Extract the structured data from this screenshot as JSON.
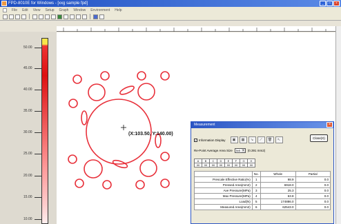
{
  "window": {
    "title": "FPD-8010E for Windows - [xxg sample fpd]"
  },
  "menu": [
    "File",
    "Edit",
    "View",
    "Setup",
    "Graph",
    "Window",
    "Environment",
    "Help"
  ],
  "scale": {
    "labels": [
      "50.00",
      "45.00",
      "40.00",
      "35.00",
      "30.00",
      "25.00",
      "20.00",
      "15.00",
      "10.00"
    ]
  },
  "canvas": {
    "coordinate": "(X:103.50, Y:140.00)"
  },
  "dialog": {
    "title": "Measurement",
    "info_display_label": "Information Display",
    "close_label": "Close(X)",
    "rp_area_label": "Re-Point Average Area Size",
    "rp_area_value": "5x5",
    "rp_area_unit": "(0.391 mm2)",
    "letters": [
      "A",
      "B",
      "C",
      "D",
      "E",
      "F",
      "G",
      "H"
    ],
    "letter_values": [
      "00",
      "00",
      "00",
      "00",
      "00",
      "00",
      "00",
      "00"
    ],
    "columns": [
      "No.",
      "Whole",
      "Partial"
    ],
    "rows": [
      {
        "label": "Prescale Effective Ratio(%)",
        "no": "1",
        "whole": "98.9",
        "partial": "0.0"
      },
      {
        "label": "Pressed Area(mm2)",
        "no": "2",
        "whole": "6918.0",
        "partial": "0.0"
      },
      {
        "label": "Ave Pressure(MPa)",
        "no": "3",
        "whole": "25.3",
        "partial": "0.0"
      },
      {
        "label": "Max Pressure(MPa)",
        "no": "4",
        "whole": "63.8",
        "partial": "0.0"
      },
      {
        "label": "Load(N)",
        "no": "5",
        "whole": "174886.0",
        "partial": "0.0"
      },
      {
        "label": "Measured Area(mm2)",
        "no": "6",
        "whole": "62543.0",
        "partial": "0.0"
      }
    ]
  },
  "colors": {
    "pressure_ring": "#e8303a",
    "title_blue": "#2b55c4"
  }
}
